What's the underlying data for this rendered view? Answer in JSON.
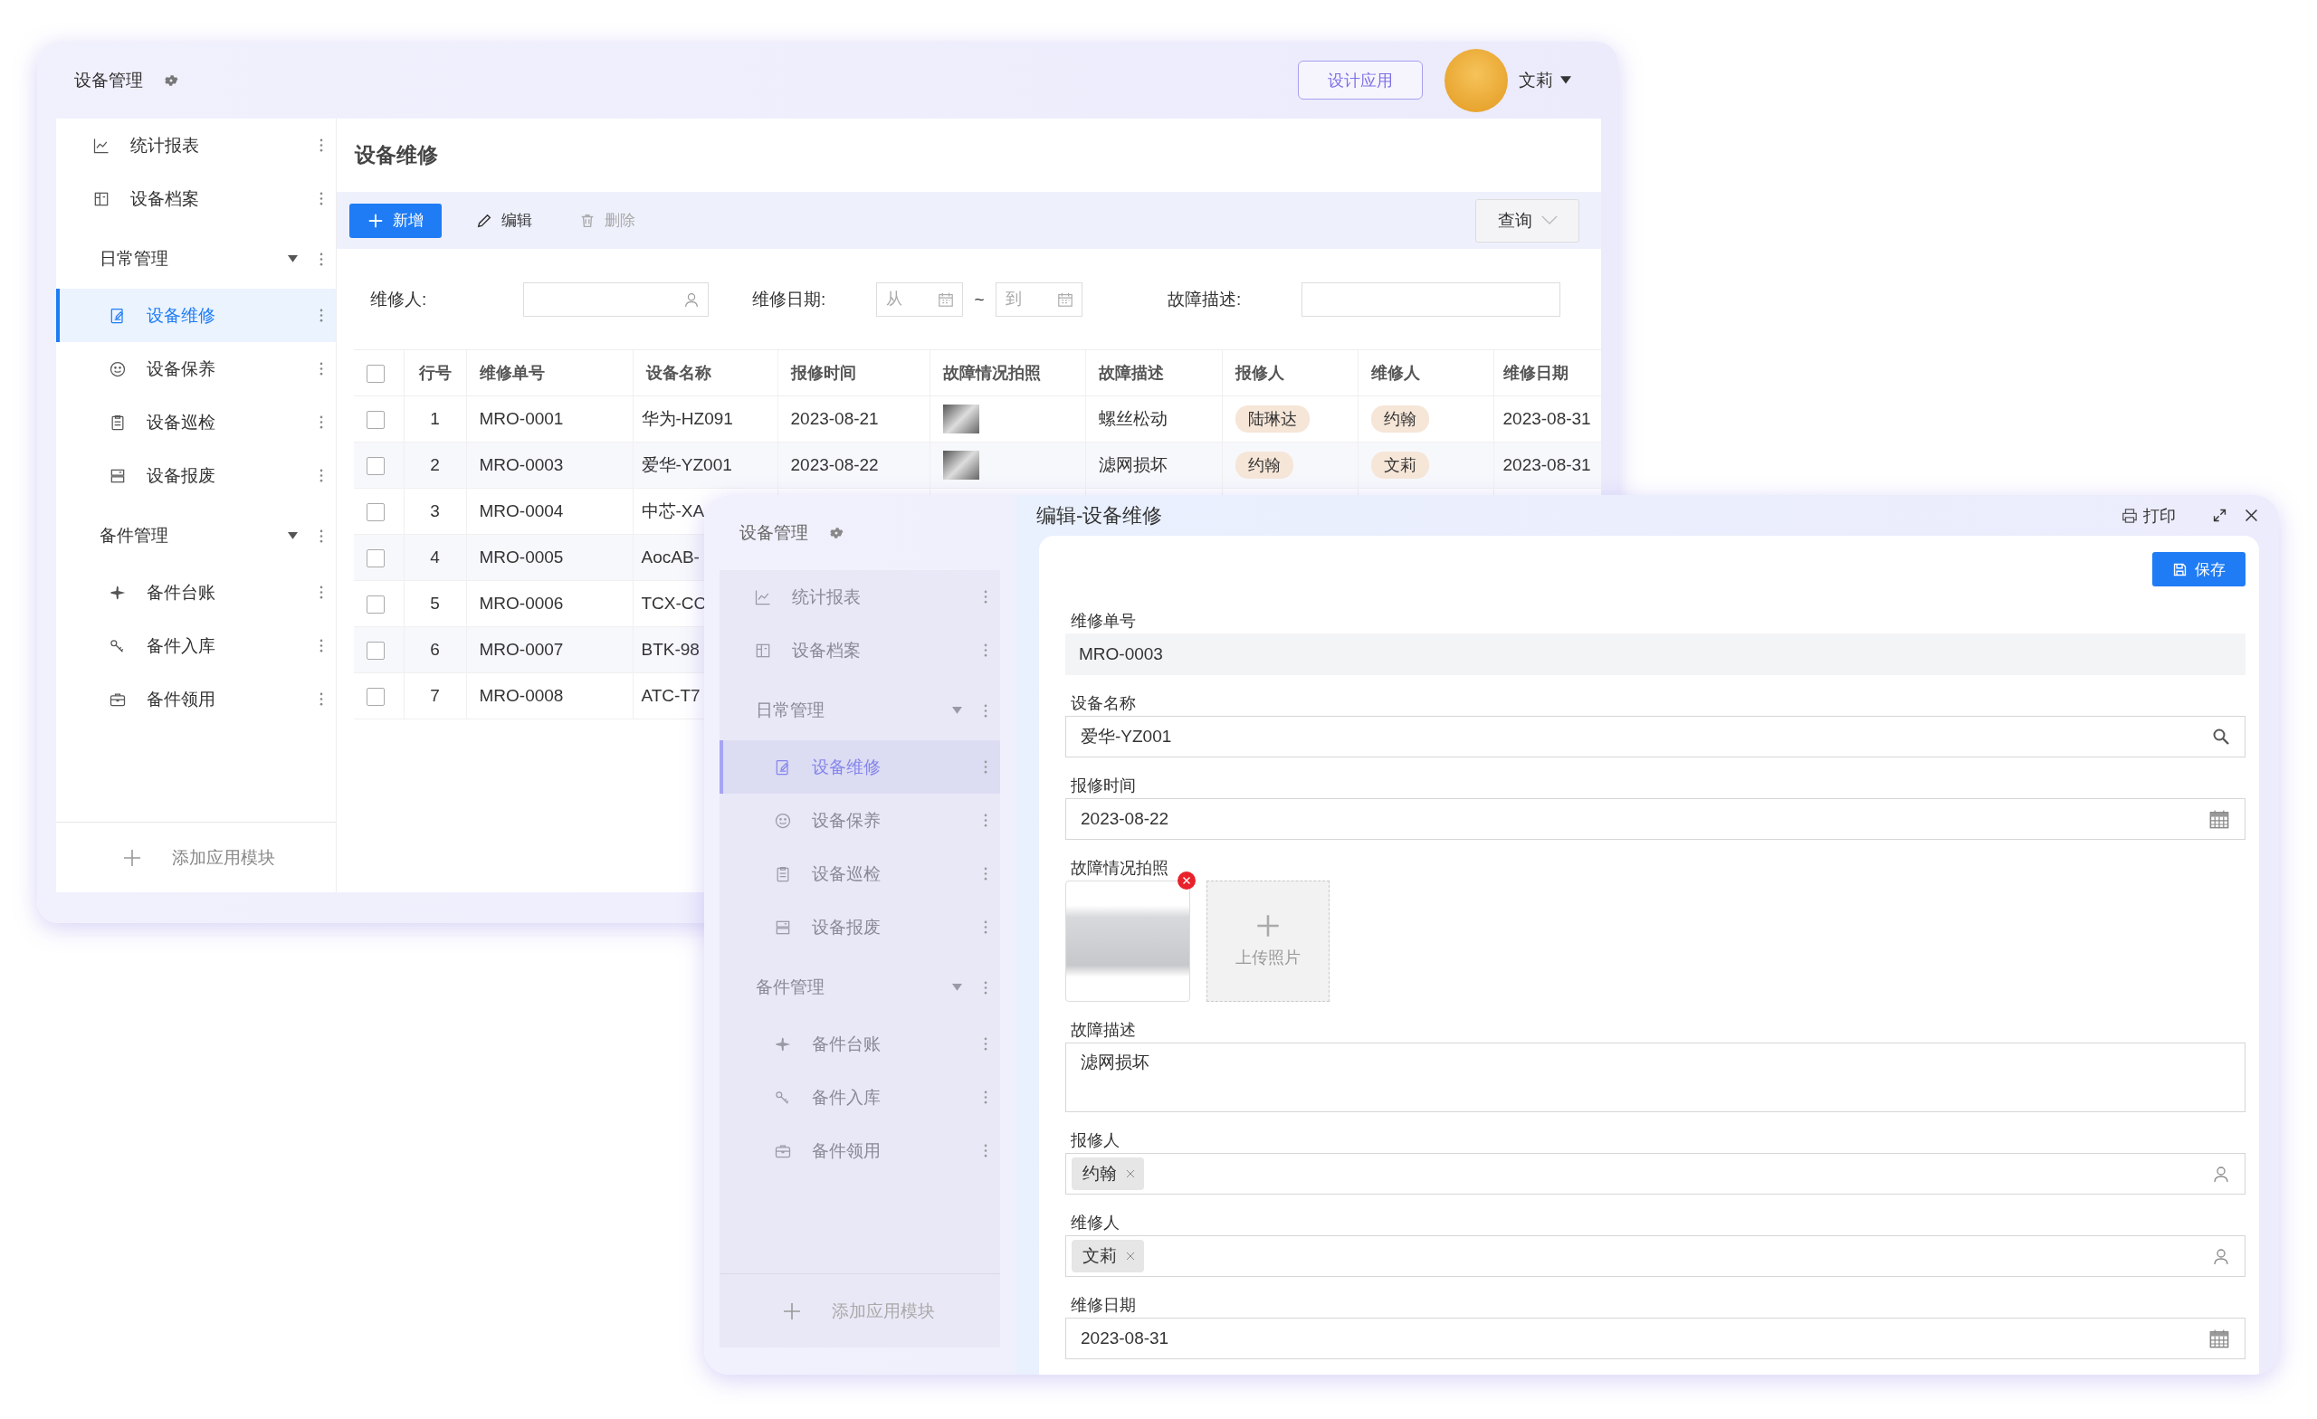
{
  "app_window": {
    "title": "设备管理",
    "design_button": "设计应用",
    "user_name": "文莉",
    "sidebar": {
      "items": [
        {
          "label": "统计报表",
          "selected": false
        },
        {
          "label": "设备档案",
          "selected": false
        },
        {
          "label": "日常管理",
          "expanded": true,
          "children": [
            {
              "label": "设备维修",
              "selected": true
            },
            {
              "label": "设备保养",
              "selected": false
            },
            {
              "label": "设备巡检",
              "selected": false
            },
            {
              "label": "设备报废",
              "selected": false
            }
          ]
        },
        {
          "label": "备件管理",
          "expanded": true,
          "children": [
            {
              "label": "备件台账",
              "selected": false
            },
            {
              "label": "备件入库",
              "selected": false
            },
            {
              "label": "备件领用",
              "selected": false
            }
          ]
        }
      ],
      "add_module": "添加应用模块"
    },
    "page": {
      "title": "设备维修",
      "toolbar": [
        {
          "kind": "primary",
          "label": "新增",
          "disabled": false
        },
        {
          "kind": "edit",
          "label": "编辑",
          "disabled": false
        },
        {
          "kind": "delete",
          "label": "删除",
          "disabled": true
        }
      ],
      "query_button": "查询",
      "filters": {
        "repairer_label": "维修人:",
        "date_label": "维修日期:",
        "date_from_placeholder": "从",
        "date_separator": "~",
        "date_to_placeholder": "到",
        "fault_label": "故障描述:"
      },
      "table": {
        "header_checked": false,
        "columns": [
          "行号",
          "维修单号",
          "设备名称",
          "报修时间",
          "故障情况拍照",
          "故障描述",
          "报修人",
          "维修人",
          "维修日期"
        ],
        "rows": [
          {
            "checked": false,
            "no": "1",
            "code": "MRO-0001",
            "device": "华为-HZ091",
            "reported": "2023-08-21",
            "photo": true,
            "fault": "螺丝松动",
            "reporter": "陆琳达",
            "repairer": "约翰",
            "date": "2023-08-31"
          },
          {
            "checked": false,
            "no": "2",
            "code": "MRO-0003",
            "device": "爱华-YZ001",
            "reported": "2023-08-22",
            "photo": true,
            "fault": "滤网损坏",
            "reporter": "约翰",
            "repairer": "文莉",
            "date": "2023-08-31"
          },
          {
            "checked": false,
            "no": "3",
            "code": "MRO-0004",
            "device": "中芯-XA"
          },
          {
            "checked": false,
            "no": "4",
            "code": "MRO-0005",
            "device": "AocAB-"
          },
          {
            "checked": false,
            "no": "5",
            "code": "MRO-0006",
            "device": "TCX-CC"
          },
          {
            "checked": false,
            "no": "6",
            "code": "MRO-0007",
            "device": "BTK-98"
          },
          {
            "checked": false,
            "no": "7",
            "code": "MRO-0008",
            "device": "ATC-T7"
          }
        ]
      }
    }
  },
  "edit_window": {
    "sidebar_title": "设备管理",
    "sidebar": {
      "items": [
        {
          "label": "统计报表",
          "selected": false
        },
        {
          "label": "设备档案",
          "selected": false
        },
        {
          "label": "日常管理",
          "expanded": true,
          "children": [
            {
              "label": "设备维修",
              "selected": true
            },
            {
              "label": "设备保养",
              "selected": false
            },
            {
              "label": "设备巡检",
              "selected": false
            },
            {
              "label": "设备报废",
              "selected": false
            }
          ]
        },
        {
          "label": "备件管理",
          "expanded": true,
          "children": [
            {
              "label": "备件台账",
              "selected": false
            },
            {
              "label": "备件入库",
              "selected": false
            },
            {
              "label": "备件领用",
              "selected": false
            }
          ]
        }
      ],
      "add_module": "添加应用模块"
    },
    "title": "编辑-设备维修",
    "print": "打印",
    "save": "保存",
    "fields": [
      {
        "kind": "readonly",
        "label": "维修单号",
        "value": "MRO-0003"
      },
      {
        "kind": "lookup",
        "label": "设备名称",
        "value": "爱华-YZ001"
      },
      {
        "kind": "date",
        "label": "报修时间",
        "value": "2023-08-22"
      },
      {
        "kind": "photos",
        "label": "故障情况拍照",
        "photos": [
          {
            "removable": true
          }
        ],
        "upload": "上传照片"
      },
      {
        "kind": "textarea",
        "label": "故障描述",
        "value": "滤网损坏"
      },
      {
        "kind": "people",
        "label": "报修人",
        "people": [
          "约翰"
        ]
      },
      {
        "kind": "people",
        "label": "维修人",
        "people": [
          "文莉"
        ]
      },
      {
        "kind": "date",
        "label": "维修日期",
        "value": "2023-08-31"
      }
    ]
  }
}
